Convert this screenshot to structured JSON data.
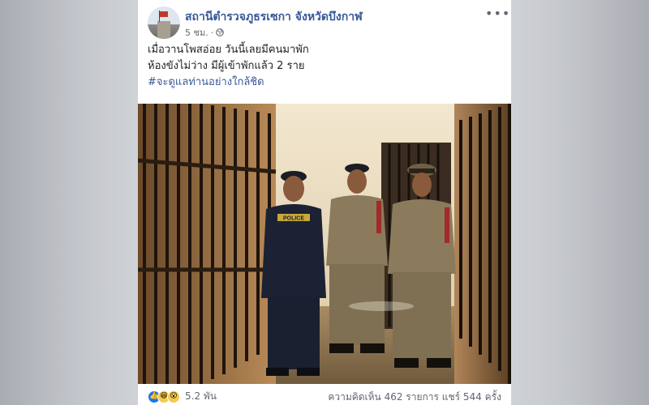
{
  "post": {
    "page_name": "สถานีตำรวจภูธรเซกา จังหวัดบึงกาฬ",
    "time": "5 ชม.",
    "time_separator": "·",
    "privacy_icon": "globe-icon",
    "more_label": "•••",
    "text_line1": "เมื่อวานโพสอ่อย วันนี้เลยมีคนมาพัก",
    "text_line2": "ห้องขังไม่ว่าง มีผู้เข้าพักแล้ว 2 ราย",
    "hashtag": "#จะดูแลท่านอย่างใกล้ชิด",
    "photo_vest_text": "POLICE"
  },
  "footer": {
    "reaction_icons": [
      "like-icon",
      "haha-icon",
      "wow-icon"
    ],
    "reaction_count": "5.2 พัน",
    "comments": "ความคิดเห็น 462 รายการ",
    "shares": "แชร์ 544 ครั้ง"
  },
  "colors": {
    "link_blue": "#385898",
    "meta_gray": "#616770",
    "like_blue": "#1877f2"
  }
}
